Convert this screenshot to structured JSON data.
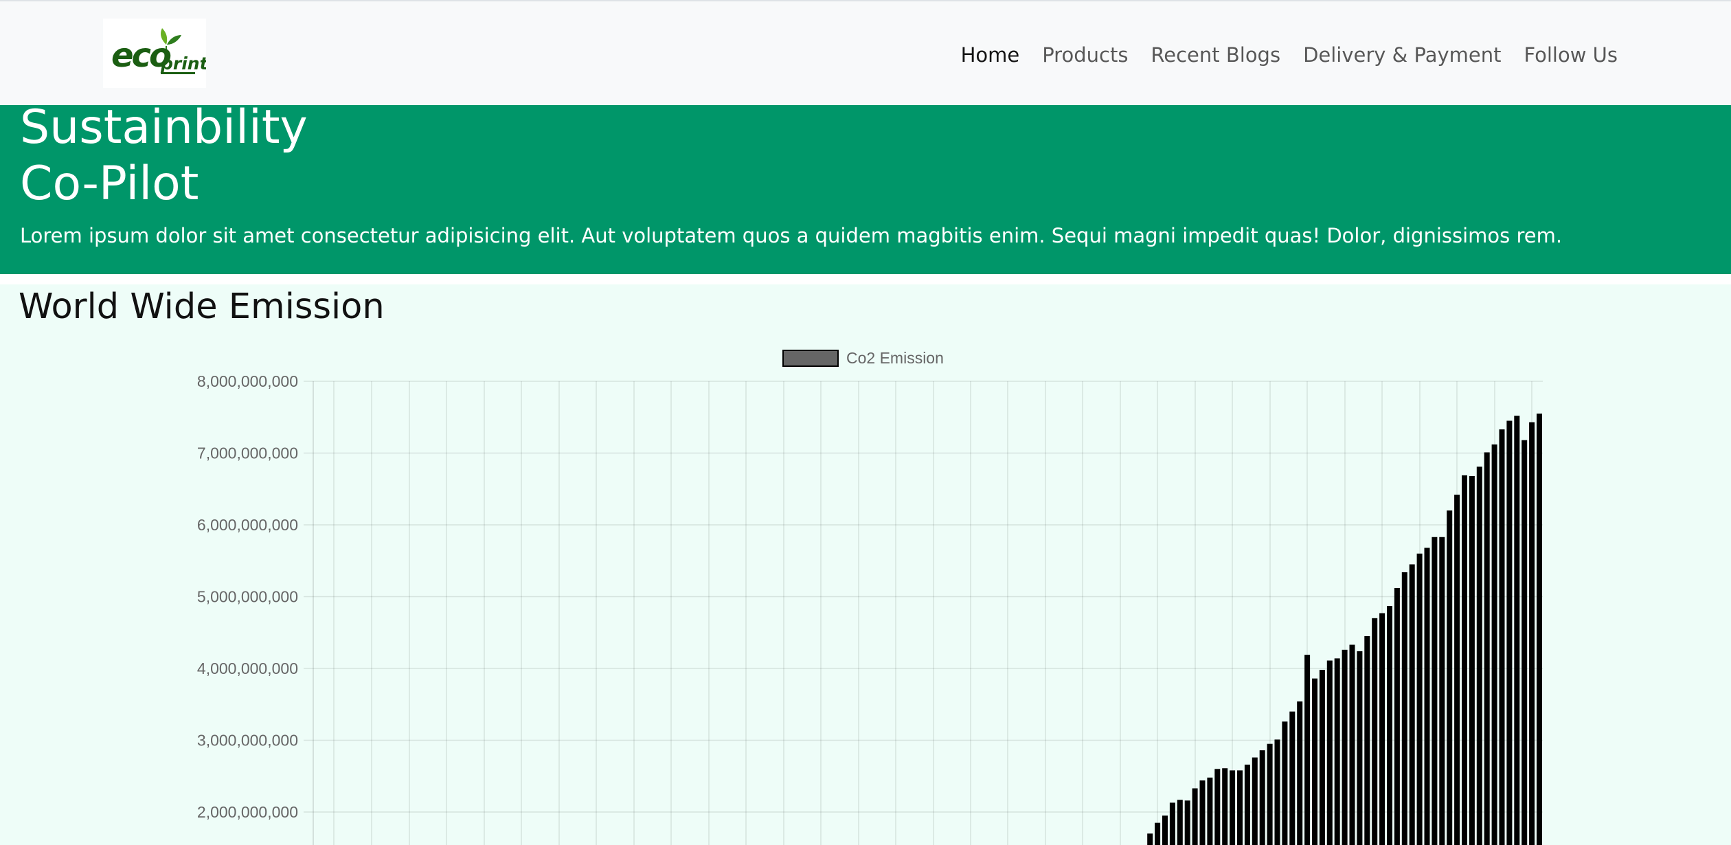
{
  "navbar": {
    "logo_text": "ecoprint",
    "links": [
      {
        "label": "Home"
      },
      {
        "label": "Products"
      },
      {
        "label": "Recent Blogs"
      },
      {
        "label": "Delivery & Payment"
      },
      {
        "label": "Follow Us"
      }
    ]
  },
  "hero": {
    "title_line1": "Sustainbility",
    "title_line2": "Co-Pilot",
    "text": "Lorem ipsum dolor sit amet consectetur adipisicing elit. Aut voluptatem quos a quidem magbitis enim. Sequi magni impedit quas! Dolor, dignissimos rem."
  },
  "emission": {
    "title": "World Wide Emission"
  },
  "colors": {
    "nav_bg": "#f8f9fa",
    "hero_bg": "#009669",
    "section_bg": "#eefdf8",
    "bar_fill": "#000000",
    "legend_fill": "#666666"
  },
  "chart_data": {
    "type": "bar",
    "title": "",
    "xlabel": "",
    "ylabel": "",
    "grid": true,
    "legend_position": "top",
    "ylim": [
      0,
      8000000000
    ],
    "yticks": [
      "8,000,000,000",
      "7,000,000,000",
      "6,000,000,000",
      "5,000,000,000",
      "4,000,000,000",
      "3,000,000,000",
      "2,000,000,000"
    ],
    "series": [
      {
        "name": "Co2 Emission",
        "values": [
          1700000000,
          1850000000,
          1950000000,
          2130000000,
          2170000000,
          2160000000,
          2330000000,
          2440000000,
          2480000000,
          2600000000,
          2610000000,
          2580000000,
          2580000000,
          2660000000,
          2760000000,
          2860000000,
          2950000000,
          3010000000,
          3260000000,
          3400000000,
          3540000000,
          4190000000,
          3860000000,
          3980000000,
          4110000000,
          4140000000,
          4260000000,
          4330000000,
          4240000000,
          4450000000,
          4700000000,
          4770000000,
          4870000000,
          5120000000,
          5340000000,
          5450000000,
          5600000000,
          5680000000,
          5830000000,
          5830000000,
          6200000000,
          6420000000,
          6690000000,
          6680000000,
          6810000000,
          7010000000,
          7120000000,
          7330000000,
          7450000000,
          7520000000,
          7180000000,
          7430000000,
          7550000000
        ]
      }
    ]
  }
}
